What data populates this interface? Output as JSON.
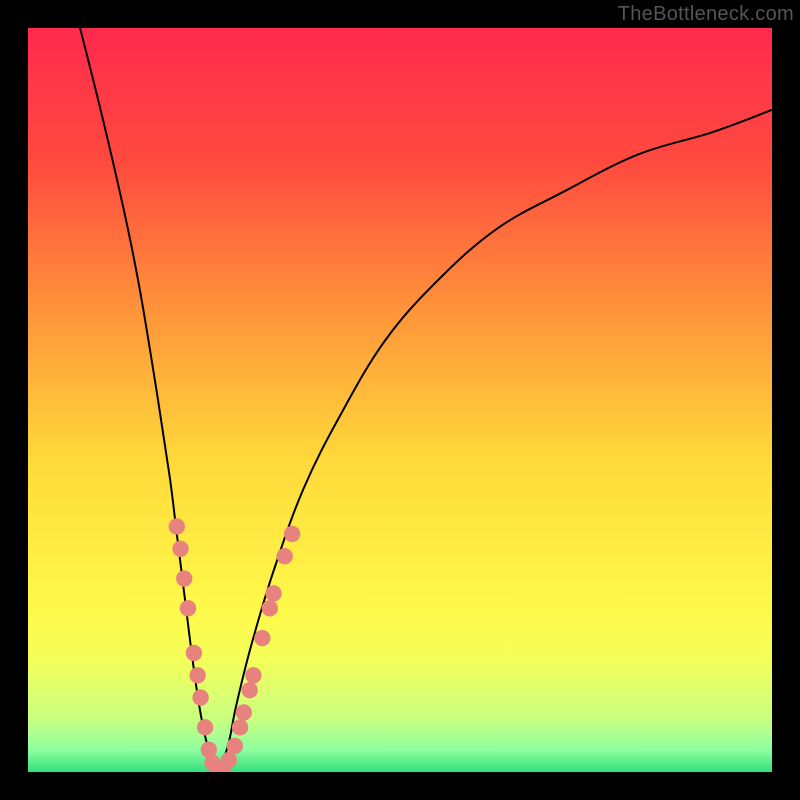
{
  "watermark": "TheBottleneck.com",
  "gradient": {
    "stops": [
      {
        "pct": 0,
        "color": "#ff2a4d"
      },
      {
        "pct": 18,
        "color": "#ff4a3f"
      },
      {
        "pct": 38,
        "color": "#ff943a"
      },
      {
        "pct": 58,
        "color": "#ffd93a"
      },
      {
        "pct": 78,
        "color": "#fff94a"
      },
      {
        "pct": 85,
        "color": "#f4ff5a"
      },
      {
        "pct": 93,
        "color": "#c8ff80"
      },
      {
        "pct": 97,
        "color": "#8effa0"
      },
      {
        "pct": 100,
        "color": "#33e07a"
      }
    ]
  },
  "chart_data": {
    "type": "line",
    "title": "",
    "xlabel": "",
    "ylabel": "",
    "xlim": [
      0,
      100
    ],
    "ylim": [
      0,
      100
    ],
    "grid": false,
    "legend_position": "none",
    "annotations": [
      "TheBottleneck.com"
    ],
    "series": [
      {
        "name": "bottleneck-curve",
        "comment": "V-shaped bottleneck curve; y≈0 at optimum, rises steeply either side. Values estimated from pixel positions against 0–100 frame.",
        "x": [
          7,
          10,
          13,
          15,
          17,
          19,
          20,
          21,
          22,
          23,
          24,
          25,
          25.5,
          26,
          27,
          28,
          30,
          33,
          37,
          42,
          48,
          55,
          63,
          72,
          82,
          92,
          100
        ],
        "y": [
          100,
          88,
          75,
          65,
          53,
          40,
          32,
          24,
          16,
          9,
          4,
          1,
          0,
          1,
          4,
          9,
          17,
          27,
          38,
          48,
          58,
          66,
          73,
          78,
          83,
          86,
          89
        ]
      }
    ],
    "scatter": {
      "name": "sample-points",
      "comment": "Salmon dots clustered near the valley on both branches; (x,y) estimated.",
      "points": [
        {
          "x": 20.0,
          "y": 33
        },
        {
          "x": 20.5,
          "y": 30
        },
        {
          "x": 21.0,
          "y": 26
        },
        {
          "x": 21.5,
          "y": 22
        },
        {
          "x": 22.3,
          "y": 16
        },
        {
          "x": 22.8,
          "y": 13
        },
        {
          "x": 23.2,
          "y": 10
        },
        {
          "x": 23.8,
          "y": 6
        },
        {
          "x": 24.3,
          "y": 3
        },
        {
          "x": 24.8,
          "y": 1.2
        },
        {
          "x": 25.5,
          "y": 0.4
        },
        {
          "x": 26.2,
          "y": 0.4
        },
        {
          "x": 27.0,
          "y": 1.6
        },
        {
          "x": 27.8,
          "y": 3.5
        },
        {
          "x": 28.5,
          "y": 6
        },
        {
          "x": 29.0,
          "y": 8
        },
        {
          "x": 29.8,
          "y": 11
        },
        {
          "x": 30.3,
          "y": 13
        },
        {
          "x": 31.5,
          "y": 18
        },
        {
          "x": 32.5,
          "y": 22
        },
        {
          "x": 33.0,
          "y": 24
        },
        {
          "x": 34.5,
          "y": 29
        },
        {
          "x": 35.5,
          "y": 32
        }
      ],
      "radius_pct": 1.1
    }
  }
}
